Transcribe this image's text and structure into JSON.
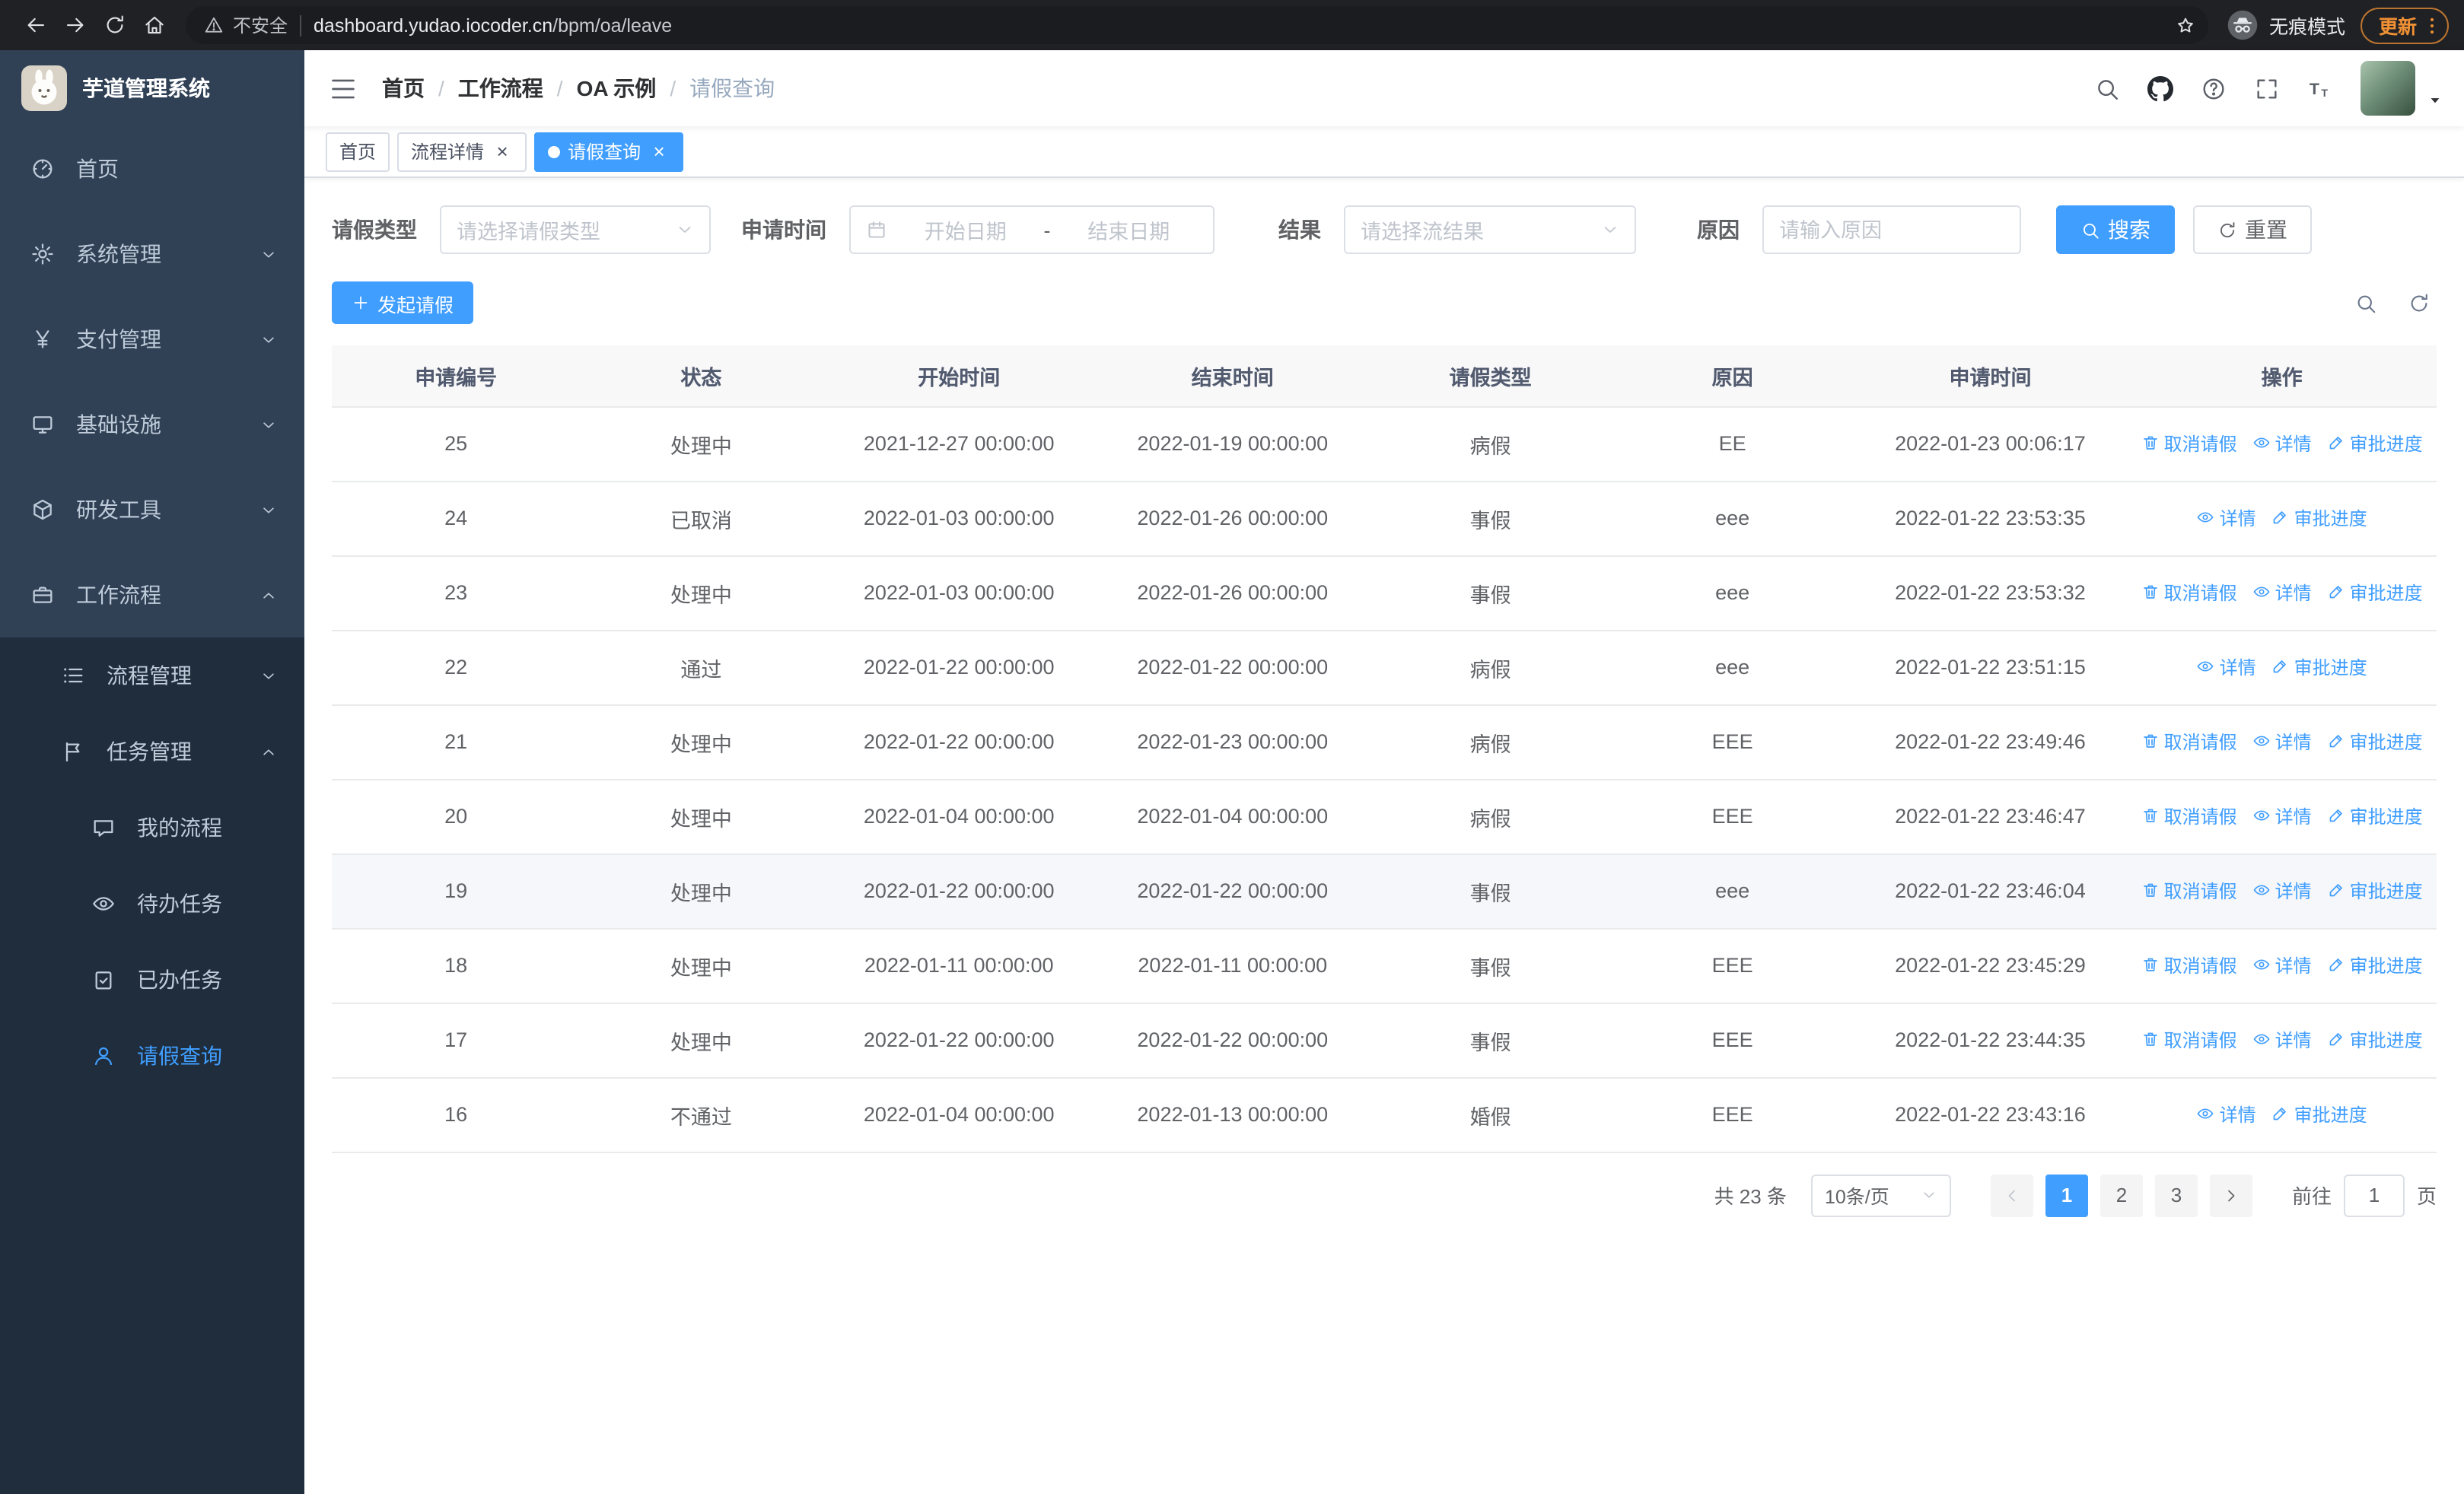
{
  "browser": {
    "security_label": "不安全",
    "url_domain": "dashboard.yudao.iocoder.cn",
    "url_path": "/bpm/oa/leave",
    "incognito_label": "无痕模式",
    "update_label": "更新"
  },
  "sidebar": {
    "app_title": "芋道管理系统",
    "items": [
      {
        "key": "home",
        "label": "首页",
        "icon": "dashboard",
        "level": 1,
        "arrow": null,
        "active": false
      },
      {
        "key": "system-management",
        "label": "系统管理",
        "icon": "gear",
        "level": 1,
        "arrow": "down",
        "active": false
      },
      {
        "key": "payment-management",
        "label": "支付管理",
        "icon": "yen",
        "level": 1,
        "arrow": "down",
        "active": false
      },
      {
        "key": "infrastructure",
        "label": "基础设施",
        "icon": "monitor",
        "level": 1,
        "arrow": "down",
        "active": false
      },
      {
        "key": "dev-tools",
        "label": "研发工具",
        "icon": "box",
        "level": 1,
        "arrow": "down",
        "active": false
      },
      {
        "key": "workflow",
        "label": "工作流程",
        "icon": "briefcase",
        "level": 1,
        "arrow": "up",
        "active": false
      },
      {
        "key": "process-management",
        "label": "流程管理",
        "icon": "list",
        "level": 2,
        "arrow": "down",
        "active": false
      },
      {
        "key": "task-management",
        "label": "任务管理",
        "icon": "flag",
        "level": 2,
        "arrow": "up",
        "active": false
      },
      {
        "key": "my-process",
        "label": "我的流程",
        "icon": "chat",
        "level": 3,
        "arrow": null,
        "active": false
      },
      {
        "key": "todo-tasks",
        "label": "待办任务",
        "icon": "eye",
        "level": 3,
        "arrow": null,
        "active": false
      },
      {
        "key": "done-tasks",
        "label": "已办任务",
        "icon": "clipboard-check",
        "level": 3,
        "arrow": null,
        "active": false
      },
      {
        "key": "leave-query",
        "label": "请假查询",
        "icon": "user",
        "level": 3,
        "arrow": null,
        "active": true
      }
    ]
  },
  "header": {
    "breadcrumbs": [
      "首页",
      "工作流程",
      "OA 示例",
      "请假查询"
    ],
    "separator": "/"
  },
  "tabs": [
    {
      "key": "home",
      "label": "首页",
      "closable": false,
      "active": false
    },
    {
      "key": "process-detail",
      "label": "流程详情",
      "closable": true,
      "active": false
    },
    {
      "key": "leave-query",
      "label": "请假查询",
      "closable": true,
      "active": true
    }
  ],
  "filters": {
    "leave_type_label": "请假类型",
    "leave_type_placeholder": "请选择请假类型",
    "apply_time_label": "申请时间",
    "start_date_placeholder": "开始日期",
    "range_separator": "-",
    "end_date_placeholder": "结束日期",
    "result_label": "结果",
    "result_placeholder": "请选择流结果",
    "reason_label": "原因",
    "reason_placeholder": "请输入原因",
    "search_label": "搜索",
    "reset_label": "重置"
  },
  "toolbar": {
    "create_label": "发起请假"
  },
  "table": {
    "columns": [
      "申请编号",
      "状态",
      "开始时间",
      "结束时间",
      "请假类型",
      "原因",
      "申请时间",
      "操作"
    ],
    "action_labels": {
      "cancel": "取消请假",
      "detail": "详情",
      "progress": "审批进度"
    },
    "rows": [
      {
        "id": "25",
        "status": "处理中",
        "start": "2021-12-27 00:00:00",
        "end": "2022-01-19 00:00:00",
        "type": "病假",
        "reason": "EE",
        "applied": "2022-01-23 00:06:17",
        "actions": [
          "cancel",
          "detail",
          "progress"
        ],
        "highlighted": false
      },
      {
        "id": "24",
        "status": "已取消",
        "start": "2022-01-03 00:00:00",
        "end": "2022-01-26 00:00:00",
        "type": "事假",
        "reason": "eee",
        "applied": "2022-01-22 23:53:35",
        "actions": [
          "detail",
          "progress"
        ],
        "highlighted": false
      },
      {
        "id": "23",
        "status": "处理中",
        "start": "2022-01-03 00:00:00",
        "end": "2022-01-26 00:00:00",
        "type": "事假",
        "reason": "eee",
        "applied": "2022-01-22 23:53:32",
        "actions": [
          "cancel",
          "detail",
          "progress"
        ],
        "highlighted": false
      },
      {
        "id": "22",
        "status": "通过",
        "start": "2022-01-22 00:00:00",
        "end": "2022-01-22 00:00:00",
        "type": "病假",
        "reason": "eee",
        "applied": "2022-01-22 23:51:15",
        "actions": [
          "detail",
          "progress"
        ],
        "highlighted": false
      },
      {
        "id": "21",
        "status": "处理中",
        "start": "2022-01-22 00:00:00",
        "end": "2022-01-23 00:00:00",
        "type": "病假",
        "reason": "EEE",
        "applied": "2022-01-22 23:49:46",
        "actions": [
          "cancel",
          "detail",
          "progress"
        ],
        "highlighted": false
      },
      {
        "id": "20",
        "status": "处理中",
        "start": "2022-01-04 00:00:00",
        "end": "2022-01-04 00:00:00",
        "type": "病假",
        "reason": "EEE",
        "applied": "2022-01-22 23:46:47",
        "actions": [
          "cancel",
          "detail",
          "progress"
        ],
        "highlighted": false
      },
      {
        "id": "19",
        "status": "处理中",
        "start": "2022-01-22 00:00:00",
        "end": "2022-01-22 00:00:00",
        "type": "事假",
        "reason": "eee",
        "applied": "2022-01-22 23:46:04",
        "actions": [
          "cancel",
          "detail",
          "progress"
        ],
        "highlighted": true
      },
      {
        "id": "18",
        "status": "处理中",
        "start": "2022-01-11 00:00:00",
        "end": "2022-01-11 00:00:00",
        "type": "事假",
        "reason": "EEE",
        "applied": "2022-01-22 23:45:29",
        "actions": [
          "cancel",
          "detail",
          "progress"
        ],
        "highlighted": false
      },
      {
        "id": "17",
        "status": "处理中",
        "start": "2022-01-22 00:00:00",
        "end": "2022-01-22 00:00:00",
        "type": "事假",
        "reason": "EEE",
        "applied": "2022-01-22 23:44:35",
        "actions": [
          "cancel",
          "detail",
          "progress"
        ],
        "highlighted": false
      },
      {
        "id": "16",
        "status": "不通过",
        "start": "2022-01-04 00:00:00",
        "end": "2022-01-13 00:00:00",
        "type": "婚假",
        "reason": "EEE",
        "applied": "2022-01-22 23:43:16",
        "actions": [
          "detail",
          "progress"
        ],
        "highlighted": false
      }
    ]
  },
  "pagination": {
    "total_label": "共 23 条",
    "page_size": "10条/页",
    "pages": [
      "1",
      "2",
      "3"
    ],
    "active_page": "1",
    "goto_label": "前往",
    "goto_value": "1",
    "page_unit": "页"
  },
  "colors": {
    "primary": "#409eff",
    "sidebar_bg": "#304156",
    "submenu_bg": "#1f2d3d",
    "chrome_bg": "#202124",
    "update_accent": "#ef9034"
  }
}
